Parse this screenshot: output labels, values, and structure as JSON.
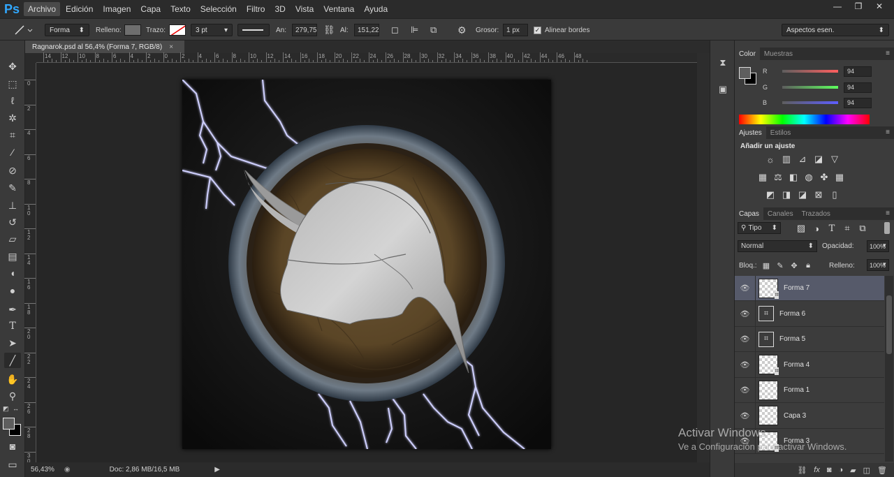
{
  "app": {
    "logo": "Ps"
  },
  "menu": [
    "Archivo",
    "Edición",
    "Imagen",
    "Capa",
    "Texto",
    "Selección",
    "Filtro",
    "3D",
    "Vista",
    "Ventana",
    "Ayuda"
  ],
  "window_controls": [
    "—",
    "❐",
    "✕"
  ],
  "options": {
    "mode": "Forma",
    "fill_label": "Relleno:",
    "stroke_label": "Trazo:",
    "stroke_size": "3 pt",
    "width_label": "An:",
    "width_value": "279,75",
    "height_label": "Al:",
    "height_value": "151,22",
    "weight_label": "Grosor:",
    "weight_value": "1 px",
    "align_label": "Alinear bordes",
    "workspace": "Aspectos esen.",
    "fill_color": "#6e6e6e"
  },
  "document": {
    "tab_title": "Ragnarok.psd al 56,4% (Forma 7, RGB/8)",
    "close": "×"
  },
  "rulers": {
    "horizontal": [
      "14",
      "12",
      "10",
      "8",
      "6",
      "4",
      "2",
      "0",
      "2",
      "4",
      "6",
      "8",
      "10",
      "12",
      "14",
      "16",
      "18",
      "20",
      "22",
      "24",
      "26",
      "28",
      "30",
      "32",
      "34",
      "36",
      "38",
      "40",
      "42",
      "44",
      "46",
      "48"
    ],
    "vertical": [
      "0",
      "2",
      "4",
      "6",
      "8",
      "1 0",
      "1 2",
      "1 4",
      "1 6",
      "1 8",
      "2 0",
      "2 2",
      "2 4",
      "2 6",
      "2 8",
      "3 0"
    ]
  },
  "status": {
    "zoom": "56,43%",
    "doc": "Doc: 2,86 MB/16,5 MB"
  },
  "color_panel": {
    "tabs": [
      "Color",
      "Muestras"
    ],
    "r_label": "R",
    "g_label": "G",
    "b_label": "B",
    "r": "94",
    "g": "94",
    "b": "94",
    "fg_color": "#5e5e5e",
    "bg_color": "#000000"
  },
  "adjust_panel": {
    "tabs": [
      "Ajustes",
      "Estilos"
    ],
    "heading": "Añadir un ajuste"
  },
  "layers_panel": {
    "tabs": [
      "Capas",
      "Canales",
      "Trazados"
    ],
    "filter": "Tipo",
    "blend": "Normal",
    "opacity_label": "Opacidad:",
    "opacity": "100%",
    "lock_label": "Bloq.:",
    "fill_label": "Relleno:",
    "fill": "100%",
    "layers": [
      {
        "name": "Forma 7",
        "type": "shape-mask",
        "selected": true
      },
      {
        "name": "Forma 6",
        "type": "shape"
      },
      {
        "name": "Forma 5",
        "type": "shape"
      },
      {
        "name": "Forma 4",
        "type": "shape-mask"
      },
      {
        "name": "Forma 1",
        "type": "raster"
      },
      {
        "name": "Capa 3",
        "type": "raster"
      },
      {
        "name": "Forma 3",
        "type": "shape-mask"
      }
    ]
  },
  "watermark": {
    "line1": "Activar Windows",
    "line2": "Ve a Configuración para activar Windows."
  }
}
